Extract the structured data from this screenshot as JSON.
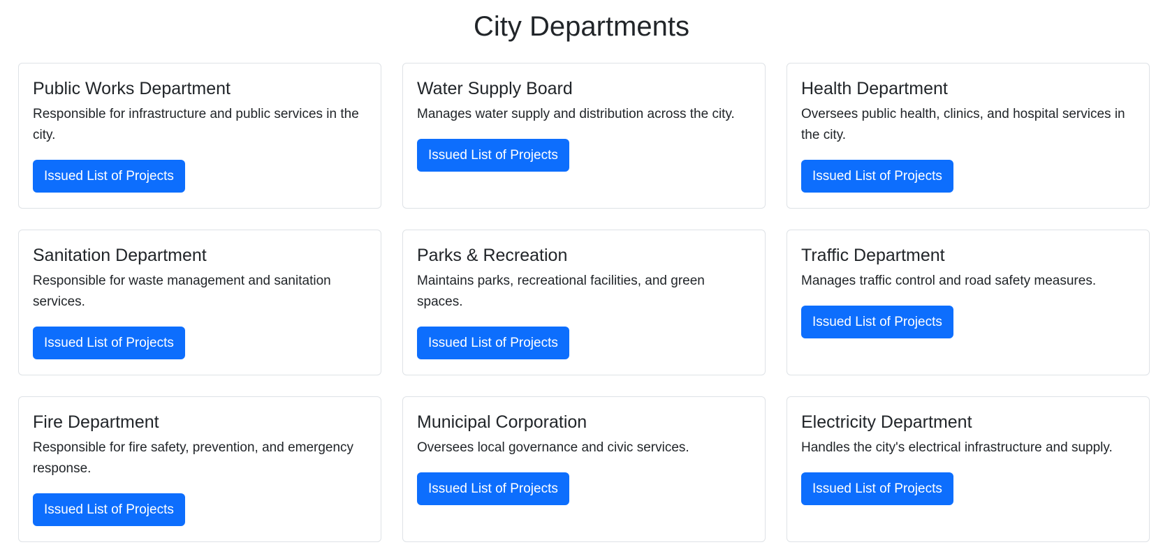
{
  "page": {
    "title": "City Departments"
  },
  "theme": {
    "accent": "#0d6efd",
    "card_border": "#dee2e6",
    "text": "#212529"
  },
  "departments": [
    {
      "name": "Public Works Department",
      "description": "Responsible for infrastructure and public services in the city.",
      "button_label": "Issued List of Projects"
    },
    {
      "name": "Water Supply Board",
      "description": "Manages water supply and distribution across the city.",
      "button_label": "Issued List of Projects"
    },
    {
      "name": "Health Department",
      "description": "Oversees public health, clinics, and hospital services in the city.",
      "button_label": "Issued List of Projects"
    },
    {
      "name": "Sanitation Department",
      "description": "Responsible for waste management and sanitation services.",
      "button_label": "Issued List of Projects"
    },
    {
      "name": "Parks & Recreation",
      "description": "Maintains parks, recreational facilities, and green spaces.",
      "button_label": "Issued List of Projects"
    },
    {
      "name": "Traffic Department",
      "description": "Manages traffic control and road safety measures.",
      "button_label": "Issued List of Projects"
    },
    {
      "name": "Fire Department",
      "description": "Responsible for fire safety, prevention, and emergency response.",
      "button_label": "Issued List of Projects"
    },
    {
      "name": "Municipal Corporation",
      "description": "Oversees local governance and civic services.",
      "button_label": "Issued List of Projects"
    },
    {
      "name": "Electricity Department",
      "description": "Handles the city's electrical infrastructure and supply.",
      "button_label": "Issued List of Projects"
    }
  ]
}
